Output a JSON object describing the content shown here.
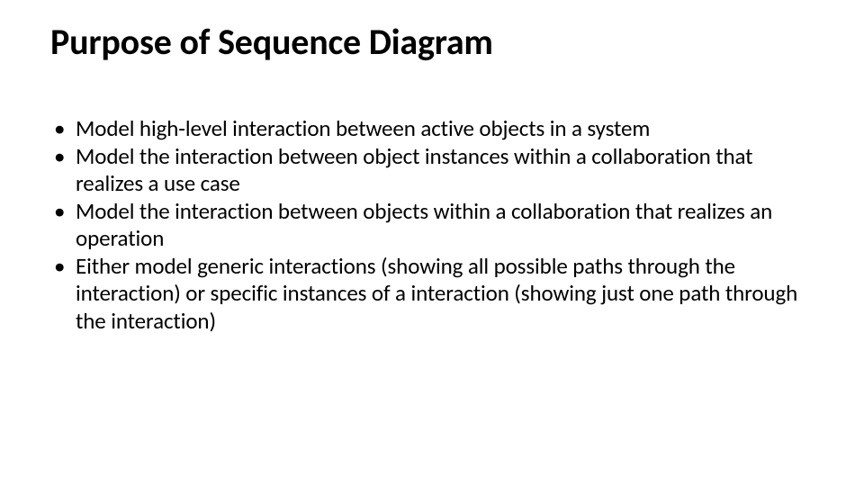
{
  "title": "Purpose of Sequence Diagram",
  "bullets": [
    "Model high-level interaction between active objects in a system",
    "Model the interaction between object instances within a collaboration that realizes a use case",
    "Model the interaction between objects within a collaboration that realizes an operation",
    "Either model generic interactions (showing all possible paths through the interaction) or specific instances of a interaction (showing just one path through the interaction)"
  ]
}
